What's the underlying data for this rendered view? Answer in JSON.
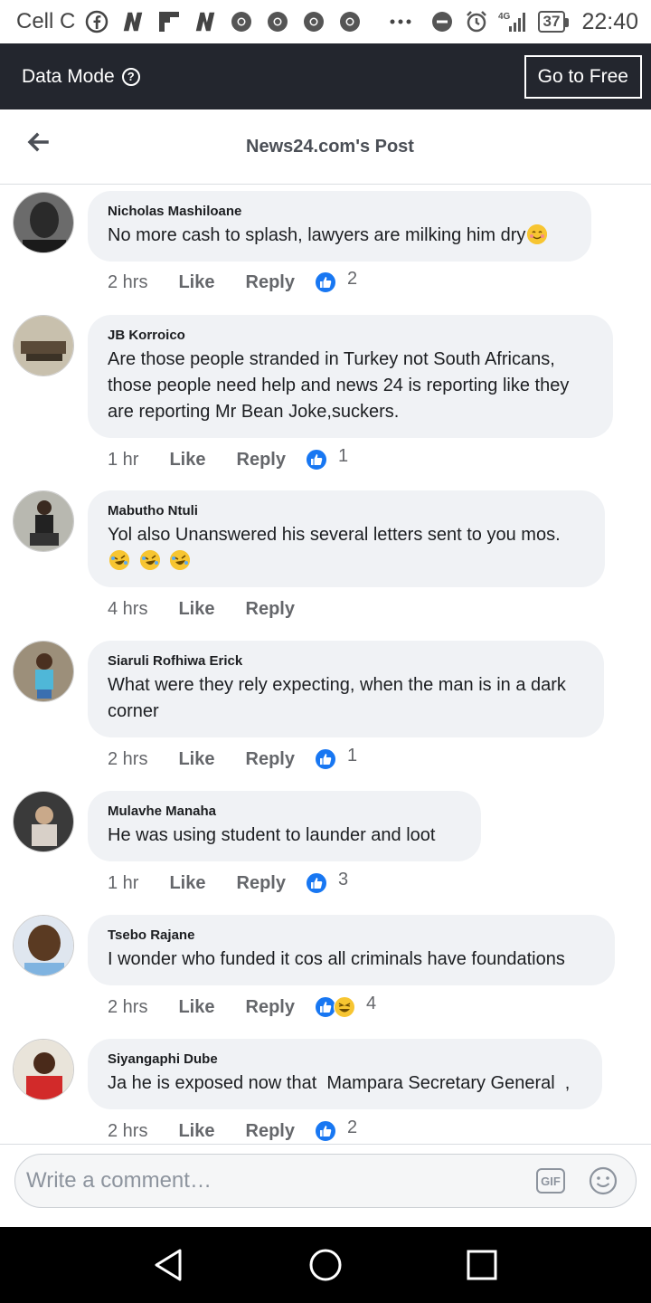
{
  "status_bar": {
    "carrier": "Cell C",
    "battery": "37",
    "time": "22:40",
    "network": "4G",
    "icons": [
      "facebook-icon",
      "news-n-icon",
      "flipboard-icon",
      "news-n-icon",
      "chrome-icon",
      "chrome-icon",
      "chrome-icon",
      "chrome-icon",
      "more-dots-icon",
      "dnd-icon",
      "alarm-icon",
      "signal-icon"
    ]
  },
  "data_bar": {
    "label": "Data Mode",
    "info_icon": "?",
    "button": "Go to Free"
  },
  "header": {
    "title": "News24.com's Post"
  },
  "comments": [
    {
      "author": "Nicholas Mashiloane",
      "text": "No more cash to splash, lawyers are milking him dry",
      "emoji": "smiling-face",
      "time": "2 hrs",
      "like": "Like",
      "reply": "Reply",
      "reactions": [
        "like"
      ],
      "count": "2"
    },
    {
      "author": "JB Korroico",
      "text": "Are those people stranded in Turkey not South Africans, those people need help and news 24 is reporting like they are reporting Mr Bean Joke,suckers.",
      "time": "1 hr",
      "like": "Like",
      "reply": "Reply",
      "reactions": [
        "like"
      ],
      "count": "1"
    },
    {
      "author": "Mabutho Ntuli",
      "text": "Yol also Unanswered his several letters sent to you mos.",
      "emoji": "rofl x3",
      "time": "4 hrs",
      "like": "Like",
      "reply": "Reply",
      "reactions": [],
      "count": ""
    },
    {
      "author": "Siaruli Rofhiwa Erick",
      "text": "What were they rely expecting, when the man is in a dark corner",
      "time": "2 hrs",
      "like": "Like",
      "reply": "Reply",
      "reactions": [
        "like"
      ],
      "count": "1"
    },
    {
      "author": "Mulavhe Manaha",
      "text": "He was using student to launder and loot",
      "time": "1 hr",
      "like": "Like",
      "reply": "Reply",
      "reactions": [
        "like"
      ],
      "count": "3"
    },
    {
      "author": "Tsebo Rajane",
      "text": "I wonder who funded it cos all criminals have foundations",
      "time": "2 hrs",
      "like": "Like",
      "reply": "Reply",
      "reactions": [
        "like",
        "haha"
      ],
      "count": "4"
    },
    {
      "author": "Siyangaphi Dube",
      "text": "Ja he is exposed now that  Mampara Secretary General  ,",
      "time": "2 hrs",
      "like": "Like",
      "reply": "Reply",
      "reactions": [
        "like"
      ],
      "count": "2"
    }
  ],
  "composer": {
    "placeholder": "Write a comment…",
    "gif": "GIF"
  },
  "colors": {
    "data_bar_bg": "#23262e",
    "bubble_bg": "#f0f2f5",
    "like_blue": "#1877f2",
    "meta_gray": "#65676b"
  }
}
